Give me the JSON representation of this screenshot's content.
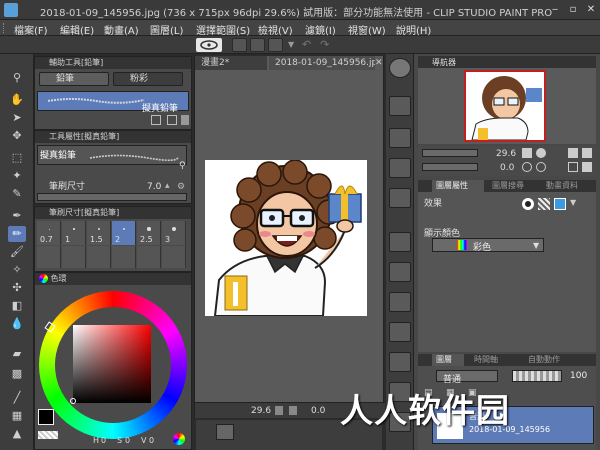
{
  "window": {
    "title": "2018-01-09_145956.jpg (736 x 715px 96dpi 29.6%)  試用版：部分功能無法使用 - CLIP STUDIO PAINT PRO",
    "minimize": "‒",
    "maximize": "▫",
    "close": "✕"
  },
  "menu": [
    "檔案(F)",
    "編輯(E)",
    "動畫(A)",
    "圖層(L)",
    "選擇範圍(S)",
    "檢視(V)",
    "濾鏡(I)",
    "視窗(W)",
    "說明(H)"
  ],
  "sub_tool_panel": {
    "header": "輔助工具[鉛筆]",
    "tabs": [
      "鉛筆",
      "粉彩"
    ],
    "selected_brush": "擬真鉛筆"
  },
  "tool_property_panel": {
    "header": "工具屬性[擬真鉛筆]",
    "brush_name": "擬真鉛筆",
    "brush_size_label": "筆刷尺寸",
    "brush_size_value": "7.0"
  },
  "brush_size_panel": {
    "header": "筆刷尺寸[擬真鉛筆]",
    "sizes": [
      "0.7",
      "1",
      "1.5",
      "2",
      "2.5",
      "3"
    ],
    "selected_index": 3
  },
  "color_panel": {
    "header": "色環",
    "h_label": "H",
    "h_value": "0",
    "s_label": "S",
    "s_value": "0",
    "v_label": "V",
    "v_value": "0"
  },
  "canvas": {
    "tabs": [
      "漫畫2*",
      "2018-01-09_145956.jpg"
    ],
    "zoom": "29.6",
    "rotation": "0.0"
  },
  "navigator_panel": {
    "header": "導航器",
    "zoom": "29.6",
    "rotation": "0.0"
  },
  "layer_property_panel": {
    "tabs": [
      "圖層屬性",
      "圖層搜尋",
      "動畫資料"
    ],
    "effect_label": "效果",
    "display_color_label": "顯示顏色",
    "display_color_value": "彩色"
  },
  "layer_panel": {
    "tabs": [
      "圖層",
      "時間軸",
      "自動動作"
    ],
    "blend_mode": "普通",
    "opacity": "100",
    "layer_name": "2018-01-09_145956",
    "layer_mode": "普通"
  },
  "watermark": "人人软件园",
  "colors": {
    "accent": "#5d7bb6",
    "main_color": "#000000",
    "sub_color": "#ffffff",
    "hue_indicator": "#ff0000"
  }
}
